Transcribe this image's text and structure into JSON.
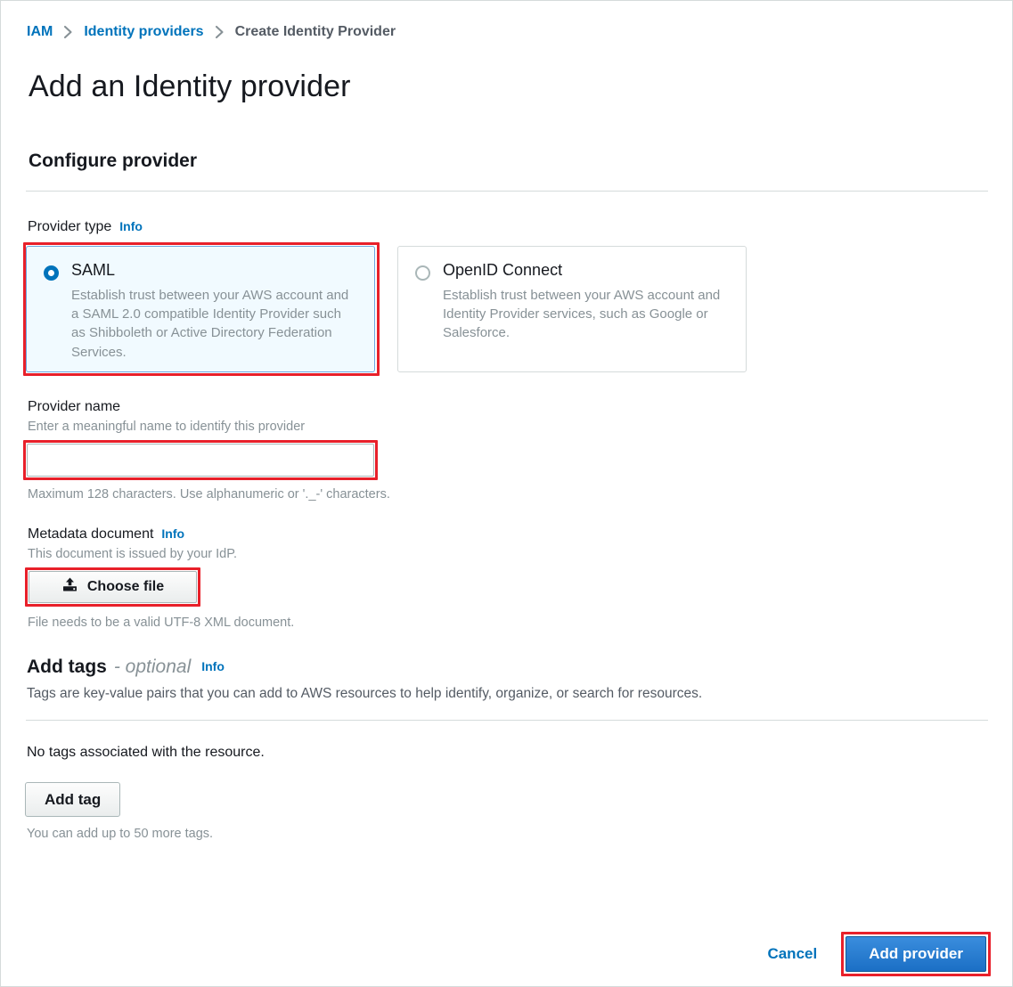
{
  "breadcrumb": {
    "items": [
      {
        "label": "IAM",
        "type": "link"
      },
      {
        "label": "Identity providers",
        "type": "link"
      },
      {
        "label": "Create Identity Provider",
        "type": "current"
      }
    ],
    "separator": "›"
  },
  "page": {
    "title": "Add an Identity provider"
  },
  "configure_provider": {
    "heading": "Configure provider",
    "provider_type": {
      "label": "Provider type",
      "info_label": "Info",
      "options": [
        {
          "id": "saml",
          "title": "SAML",
          "description": "Establish trust between your AWS account and a SAML 2.0 compatible Identity Provider such as Shibboleth or Active Directory Federation Services.",
          "selected": true,
          "highlighted": true
        },
        {
          "id": "oidc",
          "title": "OpenID Connect",
          "description": "Establish trust between your AWS account and Identity Provider services, such as Google or Salesforce.",
          "selected": false,
          "highlighted": false
        }
      ]
    },
    "provider_name": {
      "label": "Provider name",
      "hint": "Enter a meaningful name to identify this provider",
      "value": "",
      "placeholder": "",
      "constraint": "Maximum 128 characters. Use alphanumeric or '._-' characters.",
      "highlighted": true
    },
    "metadata_document": {
      "label": "Metadata document",
      "info_label": "Info",
      "hint": "This document is issued by your IdP.",
      "button_label": "Choose file",
      "button_icon": "upload-icon",
      "constraint": "File needs to be a valid UTF-8 XML document.",
      "highlighted": true
    }
  },
  "add_tags": {
    "heading": "Add tags",
    "optional_suffix": "- optional",
    "info_label": "Info",
    "description": "Tags are key-value pairs that you can add to AWS resources to help identify, organize, or search for resources.",
    "empty_state": "No tags associated with the resource.",
    "add_tag_label": "Add tag",
    "limit_text": "You can add up to 50 more tags."
  },
  "footer": {
    "cancel_label": "Cancel",
    "submit_label": "Add provider",
    "submit_highlighted": true
  },
  "colors": {
    "link": "#0073bb",
    "annotation": "#e8202a",
    "primary_button": "#2c7fd0",
    "selected_card_bg": "#f1faff",
    "selected_card_border": "#6aa6e0",
    "muted_text": "#879196",
    "divider": "#d5dbdb"
  }
}
